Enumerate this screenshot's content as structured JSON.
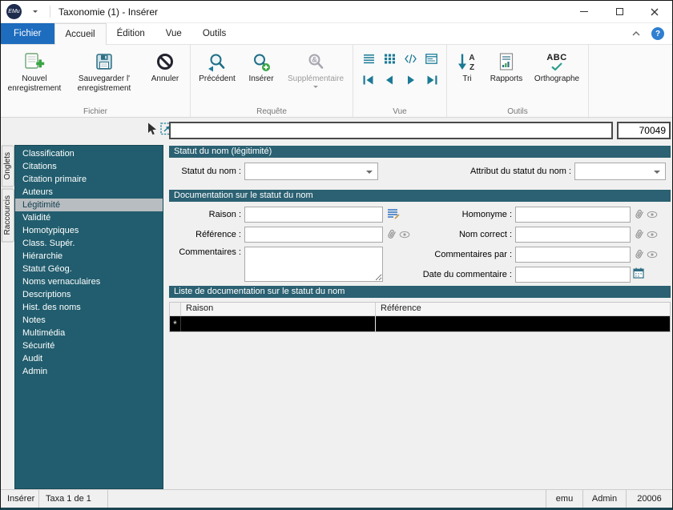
{
  "colors": {
    "teal_sidebar": "#215d6e",
    "teal_header": "#2b6172",
    "teal_icon": "#1b7a96",
    "file_tab_blue": "#1d6cbe",
    "green_accent": "#3aa546",
    "selected_item_bg": "#b8bdc1"
  },
  "titlebar": {
    "logo_text": "EMu",
    "title": "Taxonomie (1) - Insérer"
  },
  "menu": {
    "tabs": [
      "Fichier",
      "Accueil",
      "Édition",
      "Vue",
      "Outils"
    ],
    "help_glyph": "?"
  },
  "ribbon": {
    "file_group": {
      "label": "Fichier",
      "new_record": "Nouvel enregistrement",
      "save_record": [
        "Sauvegarder l'",
        "enregistrement"
      ],
      "cancel": "Annuler"
    },
    "query_group": {
      "label": "Requête",
      "previous": "Précédent",
      "insert": "Insérer",
      "additional": "Supplémentaire",
      "additional_glyph": "&"
    },
    "view_group": {
      "label": "Vue"
    },
    "tools_group": {
      "label": "Outils",
      "sort": "Tri",
      "reports": "Rapports",
      "spelling": "Orthographe",
      "spell_icon_text": "ABC",
      "sort_letter_top": "A",
      "sort_letter_bottom": "Z"
    }
  },
  "record_bar": {
    "summary_value": "",
    "irn": "70049"
  },
  "sidebar": {
    "tabs": [
      "Onglets",
      "Raccourcis"
    ],
    "items": [
      "Classification",
      "Citations",
      "Citation primaire",
      "Auteurs",
      "Légitimité",
      "Validité",
      "Homotypiques",
      "Class. Supér.",
      "Hiérarchie",
      "Statut Géog.",
      "Noms vernaculaires",
      "Descriptions",
      "Hist. des noms",
      "Notes",
      "Multimédia",
      "Sécurité",
      "Audit",
      "Admin"
    ],
    "selected_item": "Légitimité"
  },
  "form": {
    "section_statut": {
      "title": "Statut du nom (légitimité)",
      "label_statut": "Statut du nom :",
      "label_attribut": "Attribut du statut du nom :",
      "statut_value": "",
      "attribut_value": ""
    },
    "section_doc": {
      "title": "Documentation sur le statut du nom",
      "label_raison": "Raison :",
      "label_reference": "Référence :",
      "label_commentaires": "Commentaires :",
      "label_homonyme": "Homonyme :",
      "label_nom_correct": "Nom correct :",
      "label_commentaires_par": "Commentaires par :",
      "label_date": "Date du commentaire :"
    },
    "section_liste": {
      "title": "Liste de documentation sur le statut du nom",
      "columns": [
        "Raison",
        "Référence"
      ],
      "new_row_marker": "*"
    }
  },
  "status_bar": {
    "mode": "Insérer",
    "position": "Taxa 1 de 1",
    "user": "emu",
    "account": "Admin",
    "port": "20006"
  }
}
